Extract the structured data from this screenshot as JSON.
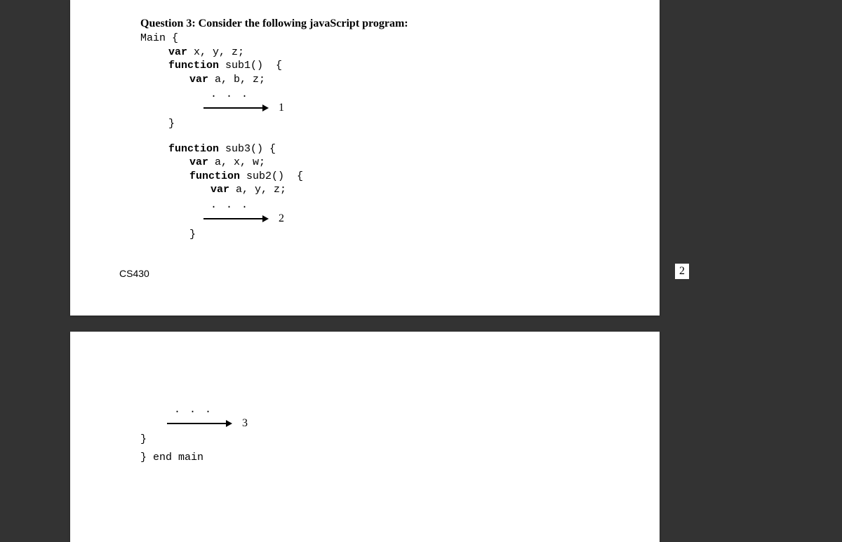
{
  "question": {
    "title": "Question 3: Consider the following javaScript program:"
  },
  "code": {
    "main_open": "Main {",
    "var_xyz": "var x, y, z;",
    "func_sub1_open": "function sub1()  {",
    "var_abz": "var a, b, z;",
    "close_brace": "}",
    "func_sub3_open": "function sub3() {",
    "var_axw": "var a, x, w;",
    "func_sub2_open": "function sub2()  {",
    "var_ayz": "var a, y, z;",
    "end_main": "} end main",
    "kw_var": "var",
    "kw_function": "function",
    "sub1_name": " sub1()  {",
    "sub3_name": " sub3() {",
    "sub2_name": " sub2()  {",
    "rest_xyz": " x, y, z;",
    "rest_abz": " a, b, z;",
    "rest_axw": " a, x, w;",
    "rest_ayz": " a, y, z;"
  },
  "arrows": {
    "dots": ". . .",
    "label_1": "1",
    "label_2": "2",
    "label_3": "3"
  },
  "footer": {
    "course": "CS430"
  },
  "margin": {
    "page_number": "2"
  }
}
